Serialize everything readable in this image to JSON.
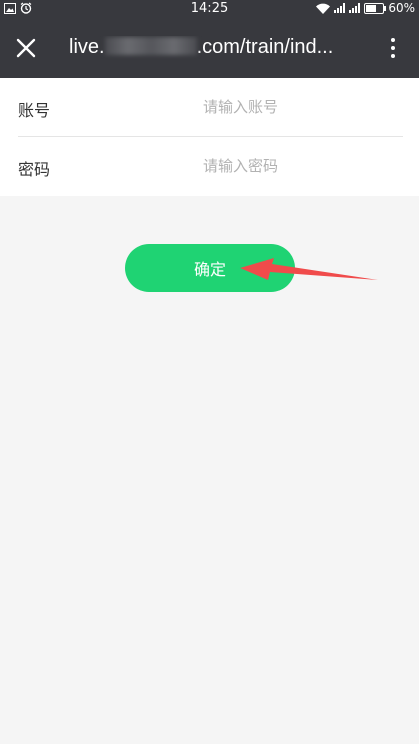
{
  "status_bar": {
    "time": "14:25",
    "battery": "60%",
    "battery_level": 0.6,
    "icons_left": [
      "image-icon",
      "alarm-icon"
    ],
    "icons_right": [
      "wifi-icon",
      "signal-icon",
      "signal-icon",
      "battery-icon"
    ]
  },
  "nav": {
    "url_prefix": "live.",
    "url_suffix": ".com/train/ind...",
    "close_icon": "close-icon",
    "more_icon": "more-vertical-icon"
  },
  "form": {
    "account_label": "账号",
    "account_placeholder": "请输入账号",
    "password_label": "密码",
    "password_placeholder": "请输入密码"
  },
  "confirm_label": "确定",
  "colors": {
    "header": "#38393e",
    "button": "#1fd373",
    "background": "#f5f5f5",
    "arrow": "#f04b4b"
  }
}
